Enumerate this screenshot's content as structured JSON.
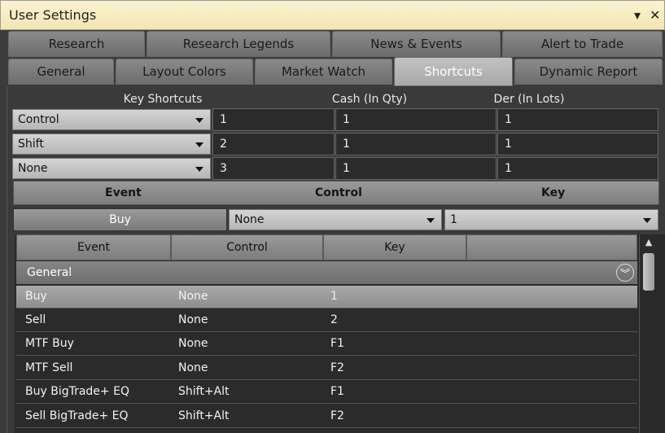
{
  "window": {
    "title": "User Settings",
    "pin_icon": "chevron-down-icon",
    "close_icon": "close-icon"
  },
  "tabs": {
    "row1": [
      "Research",
      "Research Legends",
      "News & Events",
      "Alert to Trade"
    ],
    "row2": [
      "General",
      "Layout Colors",
      "Market Watch",
      "Shortcuts",
      "Dynamic Report"
    ],
    "active": "Shortcuts"
  },
  "shortcuts": {
    "headers": {
      "key": "Key Shortcuts",
      "cash": "Cash (In Qty)",
      "der": "Der (In Lots)"
    },
    "rows": [
      {
        "key": "Control",
        "num": "1",
        "cash": "1",
        "der": "1"
      },
      {
        "key": "Shift",
        "num": "2",
        "cash": "1",
        "der": "1"
      },
      {
        "key": "None",
        "num": "3",
        "cash": "1",
        "der": "1"
      }
    ]
  },
  "event_editor": {
    "headers": {
      "event": "Event",
      "control": "Control",
      "key": "Key"
    },
    "event_value": "Buy",
    "control_value": "None",
    "key_value": "1"
  },
  "grid": {
    "columns": [
      "Event",
      "Control",
      "Key",
      ""
    ],
    "group": "General",
    "rows": [
      {
        "event": "Buy",
        "control": "None",
        "key": "1",
        "selected": true
      },
      {
        "event": "Sell",
        "control": "None",
        "key": "2",
        "selected": false
      },
      {
        "event": "MTF Buy",
        "control": "None",
        "key": "F1",
        "selected": false
      },
      {
        "event": "MTF Sell",
        "control": "None",
        "key": "F2",
        "selected": false
      },
      {
        "event": "Buy BigTrade+ EQ",
        "control": "Shift+Alt",
        "key": "F1",
        "selected": false
      },
      {
        "event": "Sell BigTrade+ EQ",
        "control": "Shift+Alt",
        "key": "F2",
        "selected": false
      }
    ]
  }
}
